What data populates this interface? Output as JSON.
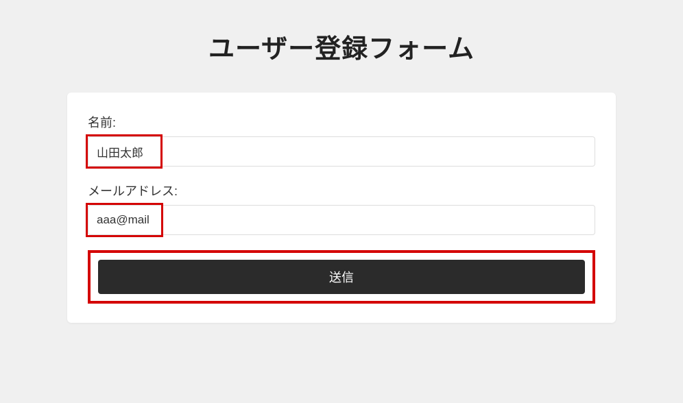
{
  "page": {
    "title": "ユーザー登録フォーム"
  },
  "form": {
    "name": {
      "label": "名前:",
      "value": "山田太郎"
    },
    "email": {
      "label": "メールアドレス:",
      "value": "aaa@mail"
    },
    "submit_label": "送信"
  },
  "annotations": {
    "highlight_color": "#d40000"
  }
}
